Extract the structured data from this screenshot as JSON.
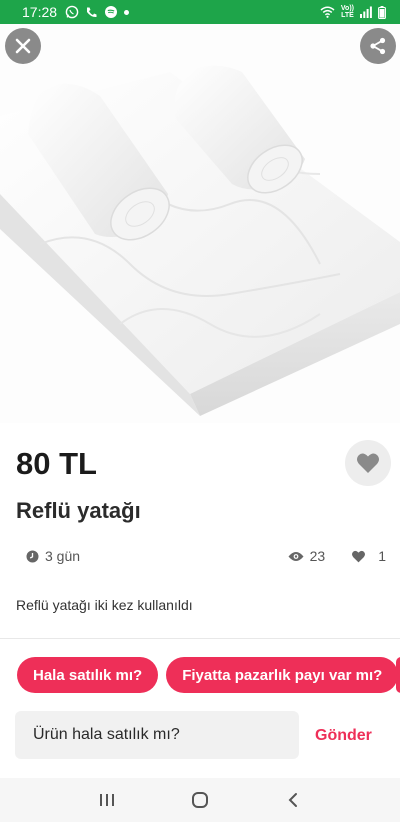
{
  "status_bar": {
    "time": "17:28",
    "left_icons": [
      "whatsapp-icon",
      "phone-icon",
      "spotify-icon",
      "dot-icon"
    ],
    "right_icons": [
      "wifi-icon",
      "volte-icon",
      "signal-icon",
      "battery-icon"
    ],
    "volte_text": "Vo))",
    "lte_text": "LTE"
  },
  "product": {
    "price": "80 TL",
    "title": "Reflü yatağı",
    "posted": "3 gün",
    "views": "23",
    "likes": "1",
    "description": "Reflü yatağı iki kez kullanıldı"
  },
  "quick_replies": [
    "Hala satılık mı?",
    "Fiyatta pazarlık payı var mı?"
  ],
  "message": {
    "value": "Ürün hala satılık mı?",
    "send_label": "Gönder"
  },
  "colors": {
    "status_bar": "#1ea54a",
    "accent": "#ee2f58",
    "overlay_button": "#8a8a8a"
  }
}
